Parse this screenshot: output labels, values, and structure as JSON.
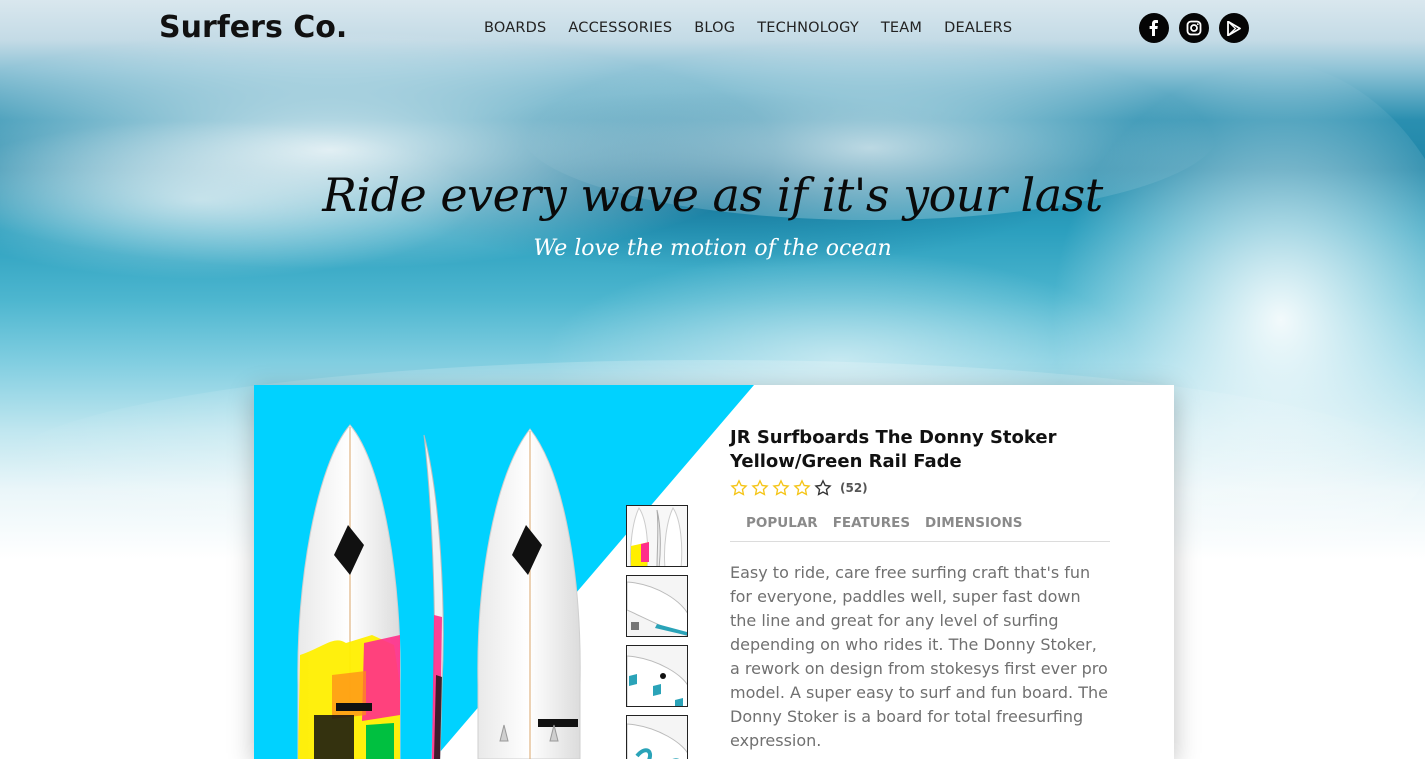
{
  "header": {
    "logo": "Surfers Co.",
    "nav": [
      "BOARDS",
      "ACCESSORIES",
      "BLOG",
      "TECHNOLOGY",
      "TEAM",
      "DEALERS"
    ],
    "social": [
      "facebook-icon",
      "instagram-icon",
      "google-play-icon"
    ]
  },
  "hero": {
    "tagline": "Ride every wave as if it's your last",
    "subline": "We love the motion of the ocean"
  },
  "product": {
    "title": "JR Surfboards The Donny Stoker Yellow/Green Rail Fade",
    "rating": {
      "stars_filled": 4,
      "stars_total": 5,
      "count": "(52)"
    },
    "tabs": [
      "POPULAR",
      "FEATURES",
      "DIMENSIONS"
    ],
    "description": "Easy to ride, care free surfing craft that's fun for everyone, paddles well, super fast down the line and great for any level of surfing depending on who rides it. The Donny Stoker, a rework on design from stokesys first ever pro model. A super easy to surf and fun board. The Donny Stoker is a board for total freesurfing expression."
  },
  "colors": {
    "accent_cyan": "#00d2ff",
    "star_yellow": "#f5c518",
    "text_dark": "#111111",
    "text_gray": "#707070"
  }
}
